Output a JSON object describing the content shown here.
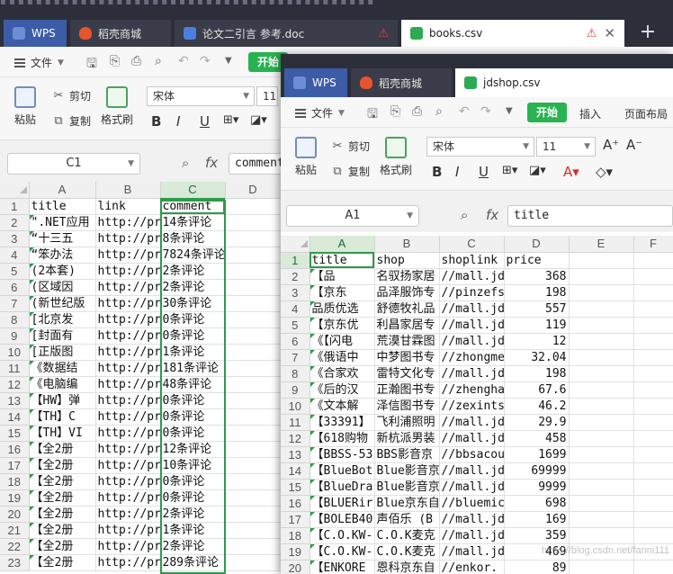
{
  "top_tabs": [
    {
      "label": "WPS"
    },
    {
      "label": "稻壳商城"
    },
    {
      "label": "论文二引言 参考.doc"
    },
    {
      "label": "books.csv"
    }
  ],
  "back": {
    "menu": {
      "file": "文件",
      "start": "开始"
    },
    "ribbon": {
      "paste": "粘贴",
      "cut": "剪切",
      "copy": "复制",
      "format_painter": "格式刷",
      "font": "宋体",
      "font_size": "11",
      "bold": "B",
      "italic": "I",
      "underline": "U"
    },
    "name_box": "C1",
    "fx": "fx",
    "formula": "comment",
    "columns": [
      "A",
      "B",
      "C",
      "D"
    ],
    "headers": [
      "title",
      "link",
      "comment"
    ],
    "rows": [
      [
        "\".NET应用",
        "http://pr",
        "14条评论"
      ],
      [
        "“十三五",
        "http://pr",
        "8条评论"
      ],
      [
        "“笨办法",
        "http://pr",
        "7824条评论"
      ],
      [
        "(2本套)",
        "http://pr",
        "2条评论"
      ],
      [
        "(区域因",
        "http://pr",
        "2条评论"
      ],
      [
        "(新世纪版",
        "http://pr",
        "30条评论"
      ],
      [
        "[北京发",
        "http://pr",
        "0条评论"
      ],
      [
        "[封面有",
        "http://pr",
        "0条评论"
      ],
      [
        "[正版图",
        "http://pr",
        "1条评论"
      ],
      [
        "《数据结",
        "http://pr",
        "181条评论"
      ],
      [
        "《电脑编",
        "http://pr",
        "48条评论"
      ],
      [
        "【HW】弹",
        "http://pr",
        "0条评论"
      ],
      [
        "【TH】C",
        "http://pr",
        "0条评论"
      ],
      [
        "【TH】VI",
        "http://pr",
        "0条评论"
      ],
      [
        "【全2册",
        "http://pr",
        "12条评论"
      ],
      [
        "【全2册",
        "http://pr",
        "10条评论"
      ],
      [
        "【全2册",
        "http://pr",
        "0条评论"
      ],
      [
        "【全2册",
        "http://pr",
        "0条评论"
      ],
      [
        "【全2册",
        "http://pr",
        "2条评论"
      ],
      [
        "【全2册",
        "http://pr",
        "1条评论"
      ],
      [
        "【全2册",
        "http://pr",
        "2条评论"
      ],
      [
        "【全2册",
        "http://pr",
        "289条评论"
      ]
    ]
  },
  "front": {
    "tabs": [
      {
        "label": "WPS"
      },
      {
        "label": "稻壳商城"
      },
      {
        "label": "jdshop.csv"
      }
    ],
    "menu": {
      "file": "文件",
      "start": "开始",
      "insert": "插入",
      "page_layout": "页面布局"
    },
    "ribbon": {
      "paste": "粘贴",
      "cut": "剪切",
      "copy": "复制",
      "format_painter": "格式刷",
      "font": "宋体",
      "font_size": "11",
      "bold": "B",
      "italic": "I",
      "underline": "U"
    },
    "name_box": "A1",
    "fx": "fx",
    "formula": "title",
    "columns": [
      "A",
      "B",
      "C",
      "D",
      "E",
      "F"
    ],
    "headers": [
      "title",
      "shop",
      "shoplink",
      "price"
    ],
    "rows": [
      [
        "【品",
        "名驭扬家居",
        "//mall.jd",
        "368"
      ],
      [
        "【京东",
        "品泽服饰专",
        "//pinzefs",
        "198"
      ],
      [
        "品质优选",
        "舒德牧礼品",
        "//mall.jd",
        "557"
      ],
      [
        "【京东优",
        "利昌家居专",
        "//mall.jd",
        "119"
      ],
      [
        "《【闪电",
        "荒漠甘霖图",
        "//mall.jd",
        "12"
      ],
      [
        "《俄语中",
        "中梦图书专",
        "//zhongme",
        "32.04"
      ],
      [
        "《合家欢",
        "雷特文化专",
        "//mall.jd",
        "198"
      ],
      [
        "《后的汉",
        "正瀚图书专",
        "//zhengha",
        "67.6"
      ],
      [
        "《文本解",
        "泽信图书专",
        "//zexints",
        "46.2"
      ],
      [
        "【33391】",
        "飞利浦照明",
        "//mall.jd",
        "29.9"
      ],
      [
        "【618购物",
        "新杭派男装",
        "//mall.jd",
        "458"
      ],
      [
        "【BBSS-53",
        "BBS影音京",
        "//bbsacou",
        "1699"
      ],
      [
        "【BlueBot",
        "Blue影音京",
        "//mall.jd",
        "69999"
      ],
      [
        "【BlueDra",
        "Blue影音京",
        "//mall.jd",
        "9999"
      ],
      [
        "【BLUERir",
        "Blue京东自",
        "//bluemic",
        "698"
      ],
      [
        "【BOLEB40",
        "声佰乐 (B",
        "//mall.jd",
        "169"
      ],
      [
        "【C.O.KW-",
        "C.O.K麦克",
        "//mall.jd",
        "359"
      ],
      [
        "【C.O.KW-",
        "C.O.K麦克",
        "//mall.jd",
        "469"
      ],
      [
        "【ENKORE",
        "恩科京东自",
        "//enkor.",
        "89"
      ]
    ]
  },
  "watermark": "https://blog.csdn.net/fanni111"
}
